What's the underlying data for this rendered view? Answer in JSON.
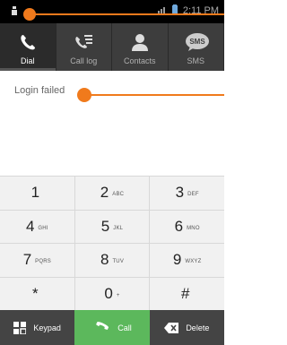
{
  "status_bar": {
    "time": "2:11 PM"
  },
  "tabs": [
    {
      "label": "Dial",
      "icon": "phone-icon",
      "active": true
    },
    {
      "label": "Call log",
      "icon": "call-log-icon",
      "active": false
    },
    {
      "label": "Contacts",
      "icon": "person-icon",
      "active": false
    },
    {
      "label": "SMS",
      "icon": "sms-bubble-icon",
      "active": false,
      "badge": "SMS"
    }
  ],
  "display": {
    "message": "Login failed"
  },
  "keypad": {
    "rows": [
      [
        {
          "digit": "1",
          "letters": ""
        },
        {
          "digit": "2",
          "letters": "ABC"
        },
        {
          "digit": "3",
          "letters": "DEF"
        }
      ],
      [
        {
          "digit": "4",
          "letters": "GHI"
        },
        {
          "digit": "5",
          "letters": "JKL"
        },
        {
          "digit": "6",
          "letters": "MNO"
        }
      ],
      [
        {
          "digit": "7",
          "letters": "PQRS"
        },
        {
          "digit": "8",
          "letters": "TUV"
        },
        {
          "digit": "9",
          "letters": "WXYZ"
        }
      ],
      [
        {
          "digit": "*",
          "letters": ""
        },
        {
          "digit": "0",
          "letters": "+"
        },
        {
          "digit": "#",
          "letters": ""
        }
      ]
    ]
  },
  "actions": {
    "keypad_label": "Keypad",
    "call_label": "Call",
    "delete_label": "Delete"
  },
  "colors": {
    "annotation": "#f07a1c",
    "call_green": "#5cb85c",
    "tab_bg": "#3d3d3d"
  }
}
